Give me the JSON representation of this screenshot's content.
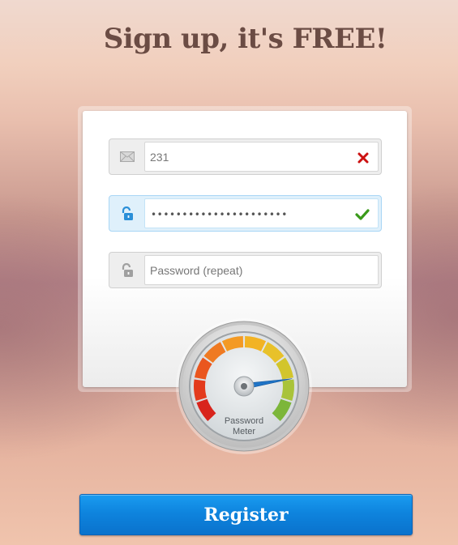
{
  "page": {
    "title": "Sign up, it's FREE!"
  },
  "form": {
    "email": {
      "value": "231",
      "icon": "envelope-icon",
      "status": "invalid",
      "status_icon": "x-mark-icon",
      "status_color": "#cc1111"
    },
    "password": {
      "masked_value": "••••••••••••••••••••••",
      "icon": "unlock-icon",
      "status": "valid",
      "status_icon": "checkmark-icon",
      "status_color": "#3a9a1a"
    },
    "password_repeat": {
      "value": "",
      "placeholder": "Password (repeat)",
      "icon": "unlock-icon"
    }
  },
  "meter": {
    "label_line1": "Password",
    "label_line2": "Meter",
    "strength": 0.8
  },
  "register": {
    "label": "Register"
  },
  "colors": {
    "accent": "#0e84de",
    "title": "#6b4c44"
  }
}
